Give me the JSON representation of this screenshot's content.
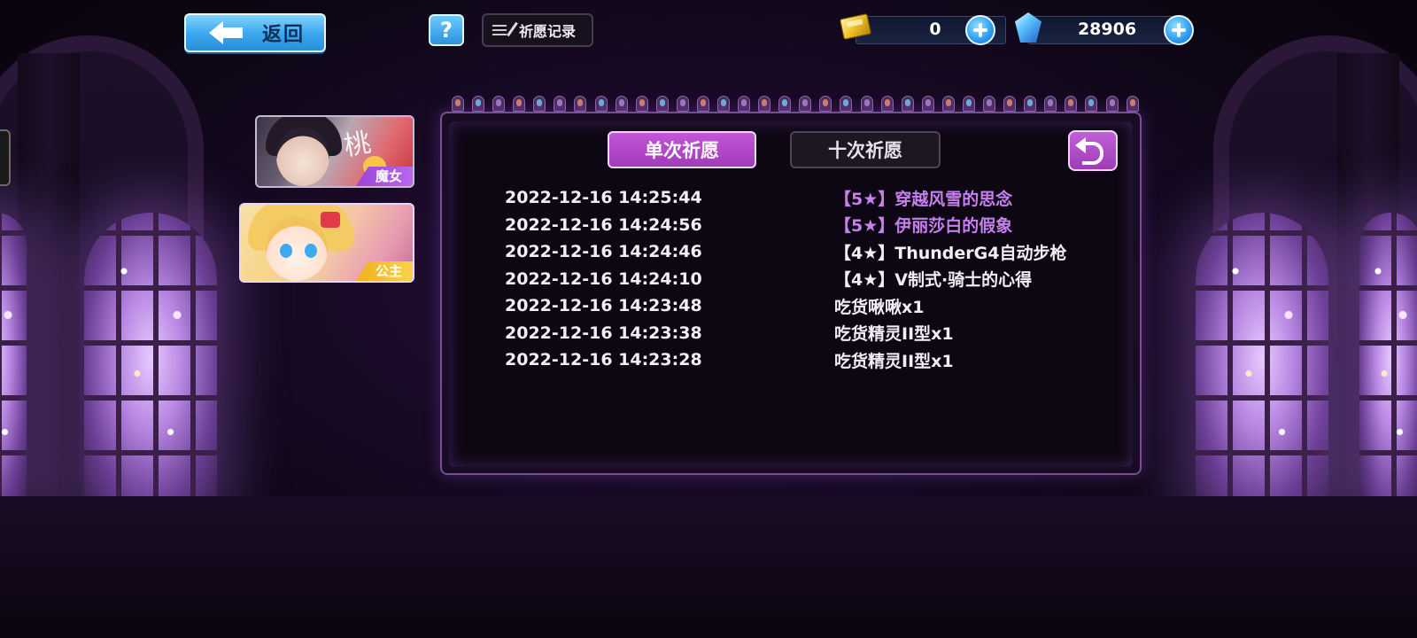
{
  "topbar": {
    "back_label": "返回",
    "help_label": "?",
    "record_label": "祈愿记录"
  },
  "currency": {
    "gold": {
      "icon": "gold-ticket-icon",
      "value": "0"
    },
    "gem": {
      "icon": "blue-crystal-icon",
      "value": "28906"
    }
  },
  "characters": [
    {
      "tag": "魔女",
      "tag_color": "#b866f0"
    },
    {
      "tag": "公主",
      "tag_color": "#f0b21a"
    }
  ],
  "panel": {
    "tabs": [
      {
        "label": "单次祈愿",
        "active": true
      },
      {
        "label": "十次祈愿",
        "active": false
      }
    ],
    "records": [
      {
        "time": "2022-12-16 14:25:44",
        "item": "【5★】穿越风雪的思念",
        "rarity": 5
      },
      {
        "time": "2022-12-16 14:24:56",
        "item": "【5★】伊丽莎白的假象",
        "rarity": 5
      },
      {
        "time": "2022-12-16 14:24:46",
        "item": "【4★】ThunderG4自动步枪",
        "rarity": 4
      },
      {
        "time": "2022-12-16 14:24:10",
        "item": "【4★】V制式·骑士的心得",
        "rarity": 4
      },
      {
        "time": "2022-12-16 14:23:48",
        "item": "吃货啾啾x1",
        "rarity": 0
      },
      {
        "time": "2022-12-16 14:23:38",
        "item": "吃货精灵II型x1",
        "rarity": 0
      },
      {
        "time": "2022-12-16 14:23:28",
        "item": "吃货精灵II型x1",
        "rarity": 0
      }
    ]
  },
  "colors": {
    "accent_purple": "#a13ab9",
    "rarity5_text": "#c77ff0",
    "button_blue": "#3aa5ee"
  }
}
